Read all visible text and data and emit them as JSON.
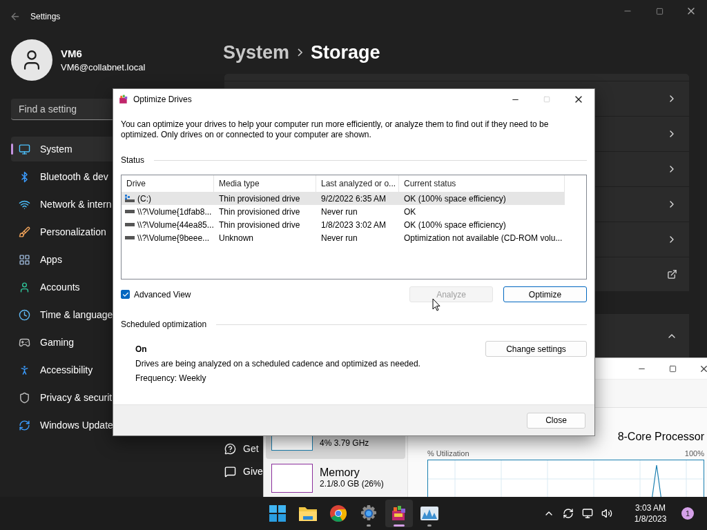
{
  "settings": {
    "title": "Settings",
    "user": {
      "name": "VM6",
      "email": "VM6@collabnet.local"
    },
    "search": {
      "placeholder": "Find a setting"
    },
    "nav": [
      {
        "kind": "system",
        "label": "System",
        "selected": true
      },
      {
        "kind": "bluetooth",
        "label": "Bluetooth & dev",
        "selected": false
      },
      {
        "kind": "network",
        "label": "Network & intern",
        "selected": false
      },
      {
        "kind": "personalization",
        "label": "Personalization",
        "selected": false
      },
      {
        "kind": "apps",
        "label": "Apps",
        "selected": false
      },
      {
        "kind": "accounts",
        "label": "Accounts",
        "selected": false
      },
      {
        "kind": "time",
        "label": "Time & language",
        "selected": false
      },
      {
        "kind": "gaming",
        "label": "Gaming",
        "selected": false
      },
      {
        "kind": "accessibility",
        "label": "Accessibility",
        "selected": false
      },
      {
        "kind": "privacy",
        "label": "Privacy & securit",
        "selected": false
      },
      {
        "kind": "update",
        "label": "Windows Update",
        "selected": false
      }
    ],
    "breadcrumb": [
      "System",
      "Storage"
    ],
    "rows": [
      {
        "kind": "link"
      },
      {
        "kind": "link"
      },
      {
        "kind": "link"
      },
      {
        "kind": "link"
      },
      {
        "kind": "link"
      },
      {
        "kind": "external"
      }
    ],
    "expander": {
      "expanded": true
    },
    "help_links": [
      {
        "kind": "help",
        "label": "Get"
      },
      {
        "kind": "feedback",
        "label": "Give"
      }
    ]
  },
  "task_manager": {
    "resources": [
      {
        "detail": "4%  3.79 GHz",
        "color": "#1a7fb0",
        "selected": true
      },
      {
        "name": "Memory",
        "detail": "2.1/8.0 GB (26%)",
        "color": "#8b2f9c",
        "selected": false
      }
    ],
    "processor": "8-Core Processor",
    "chart_label": "% Utilization",
    "chart_max": "100%"
  },
  "dialog": {
    "title": "Optimize Drives",
    "intro": "You can optimize your drives to help your computer run more efficiently, or analyze them to find out if they need to be optimized. Only drives on or connected to your computer are shown.",
    "status_label": "Status",
    "columns": [
      "Drive",
      "Media type",
      "Last analyzed or o...",
      "Current status"
    ],
    "rows": [
      {
        "kind": "system",
        "cells": [
          "(C:)",
          "Thin provisioned drive",
          "9/2/2022 6:35 AM",
          "OK (100% space efficiency)"
        ],
        "selected": true
      },
      {
        "kind": "volume",
        "cells": [
          "\\\\?\\Volume{1dfab8...",
          "Thin provisioned drive",
          "Never run",
          "OK"
        ],
        "selected": false
      },
      {
        "kind": "volume",
        "cells": [
          "\\\\?\\Volume{44ea85...",
          "Thin provisioned drive",
          "1/8/2023 3:02 AM",
          "OK (100% space efficiency)"
        ],
        "selected": false
      },
      {
        "kind": "volume",
        "cells": [
          "\\\\?\\Volume{9beee...",
          "Unknown",
          "Never run",
          "Optimization not available (CD-ROM volu..."
        ],
        "selected": false
      }
    ],
    "advanced_view": {
      "label": "Advanced View",
      "checked": true
    },
    "buttons": [
      {
        "label": "Analyze",
        "disabled": true,
        "default": false
      },
      {
        "label": "Optimize",
        "disabled": false,
        "default": true
      }
    ],
    "schedule": {
      "label": "Scheduled optimization",
      "state": "On",
      "description": "Drives are being analyzed on a scheduled cadence and optimized as needed.",
      "frequency": "Frequency: Weekly",
      "button": "Change settings"
    },
    "close": "Close"
  },
  "taskbar": {
    "apps": [
      {
        "kind": "start",
        "running": false,
        "selected": false
      },
      {
        "kind": "files",
        "running": false,
        "selected": false
      },
      {
        "kind": "browser",
        "running": false,
        "selected": false
      },
      {
        "kind": "settings",
        "running": true,
        "selected": false
      },
      {
        "kind": "defrag",
        "running": true,
        "selected": true
      },
      {
        "kind": "monitor",
        "running": true,
        "selected": false
      }
    ],
    "time": "3:03 AM",
    "date": "1/8/2023",
    "notifications": "1"
  }
}
